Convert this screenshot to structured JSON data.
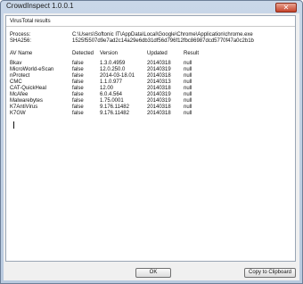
{
  "window": {
    "title": "CrowdInspect 1.0.0.1",
    "close_label": "✕"
  },
  "report": {
    "heading": "VirusTotal results",
    "process_label": "Process:",
    "process_value": "C:\\Users\\Softonic IT\\AppData\\Local\\Google\\Chrome\\Application\\chrome.exe",
    "sha_label": "SHA256:",
    "sha_value": "1525f5507d9e7ad2c14a29e6db31df56d796f12fbc86987dcd5770f47a0c2b1b",
    "columns": [
      "AV Name",
      "Detected",
      "Version",
      "Updated",
      "Result"
    ],
    "rows": [
      [
        "Bkav",
        "false",
        "1.3.0.4959",
        "20140318",
        "null"
      ],
      [
        "MicroWorld-eScan",
        "false",
        "12.0.250.0",
        "20140319",
        "null"
      ],
      [
        "nProtect",
        "false",
        "2014-03-18.01",
        "20140318",
        "null"
      ],
      [
        "CMC",
        "false",
        "1.1.0.977",
        "20140313",
        "null"
      ],
      [
        "CAT-QuickHeal",
        "false",
        "12.00",
        "20140318",
        "null"
      ],
      [
        "McAfee",
        "false",
        "6.0.4.564",
        "20140319",
        "null"
      ],
      [
        "Malwarebytes",
        "false",
        "1.75.0001",
        "20140319",
        "null"
      ],
      [
        "K7AntiVirus",
        "false",
        "9.176.11482",
        "20140318",
        "null"
      ],
      [
        "K7GW",
        "false",
        "9.176.11482",
        "20140318",
        "null"
      ]
    ]
  },
  "buttons": {
    "ok_label": "OK",
    "copy_label": "Copy to Clipboard"
  }
}
